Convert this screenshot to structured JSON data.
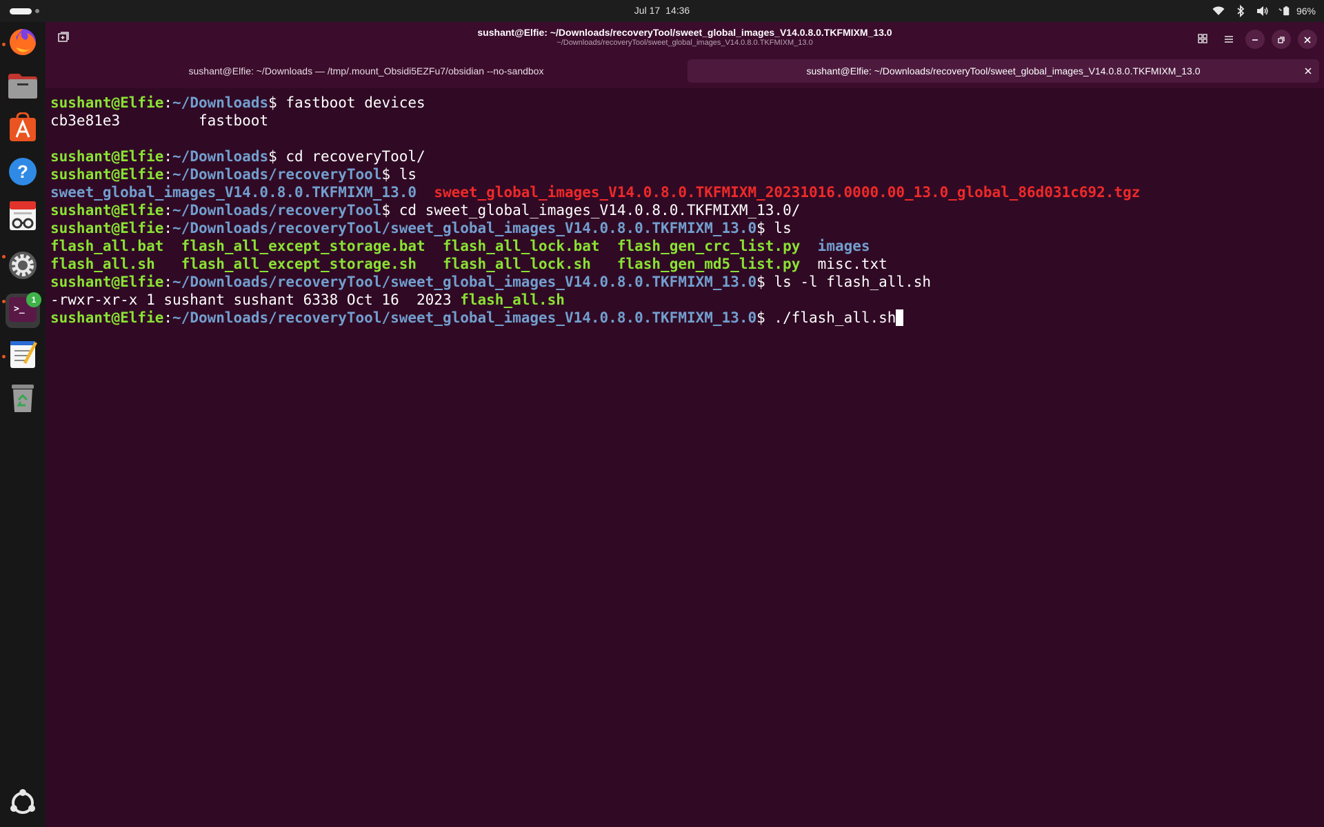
{
  "topbar": {
    "date": "Jul 17",
    "time": "14:36",
    "battery": "96%",
    "icons": [
      "wifi-icon",
      "bluetooth-icon",
      "volume-icon",
      "battery-icon"
    ]
  },
  "dock": {
    "apps": [
      "firefox",
      "files",
      "app-center",
      "help",
      "document-viewer",
      "settings",
      "terminal",
      "text-editor",
      "trash",
      "show-apps"
    ],
    "terminal_badge": "1"
  },
  "window": {
    "title": "sushant@Elfie: ~/Downloads/recoveryTool/sweet_global_images_V14.0.8.0.TKFMIXM_13.0",
    "subtitle": "~/Downloads/recoveryTool/sweet_global_images_V14.0.8.0.TKFMIXM_13.0"
  },
  "tabs": [
    {
      "label": "sushant@Elfie: ~/Downloads — /tmp/.mount_Obsidi5EZFu7/obsidian --no-sandbox",
      "active": false
    },
    {
      "label": "sushant@Elfie: ~/Downloads/recoveryTool/sweet_global_images_V14.0.8.0.TKFMIXM_13.0",
      "active": true
    }
  ],
  "terminal": {
    "colors": {
      "user": "#8ae234",
      "path": "#729fcf",
      "archive": "#ef2929",
      "background": "#300a24"
    },
    "user_host": "sushant@Elfie",
    "colon": ":",
    "dollar": "$",
    "path_downloads": "~/Downloads",
    "path_recovery": "~/Downloads/recoveryTool",
    "path_sweet": "~/Downloads/recoveryTool/sweet_global_images_V14.0.8.0.TKFMIXM_13.0",
    "cmd1": " fastboot devices",
    "out1_id": "cb3e81e3",
    "out1_state": "fastboot",
    "cmd2": " cd recoveryTool/",
    "cmd3": " ls",
    "ls1_dir": "sweet_global_images_V14.0.8.0.TKFMIXM_13.0",
    "ls1_tgz": "sweet_global_images_V14.0.8.0.TKFMIXM_20231016.0000.00_13.0_global_86d031c692.tgz",
    "cmd4": " cd sweet_global_images_V14.0.8.0.TKFMIXM_13.0/",
    "cmd5": " ls",
    "files_row1": [
      "flash_all.bat",
      "flash_all_except_storage.bat",
      "flash_all_lock.bat",
      "flash_gen_crc_list.py",
      "images"
    ],
    "files_row2": [
      "flash_all.sh",
      "flash_all_except_storage.sh",
      "flash_all_lock.sh",
      "flash_gen_md5_list.py",
      "misc.txt"
    ],
    "cmd6": " ls -l flash_all.sh",
    "ll_meta": "-rwxr-xr-x 1 sushant sushant 6338 Oct 16  2023 ",
    "ll_file": "flash_all.sh",
    "cmd7": " ./flash_all.sh"
  }
}
